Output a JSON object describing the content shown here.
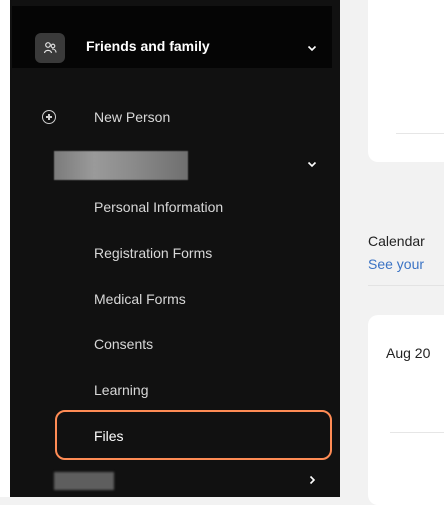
{
  "sidebar": {
    "group_title": "Friends and family",
    "new_person_label": "New Person",
    "items": [
      {
        "label": "Personal Information"
      },
      {
        "label": "Registration Forms"
      },
      {
        "label": "Medical Forms"
      },
      {
        "label": "Consents"
      },
      {
        "label": "Learning"
      },
      {
        "label": "Files"
      }
    ],
    "active_item": "Files",
    "highlight_color": "#ff8c55"
  },
  "main": {
    "calendar_title": "Calendar",
    "calendar_subtitle": "See your",
    "date_label": "Aug 20"
  },
  "icons": {
    "group": "people-icon",
    "new_person": "add-circle-icon",
    "expand": "chevron-down-icon",
    "collapsed": "chevron-right-icon"
  }
}
